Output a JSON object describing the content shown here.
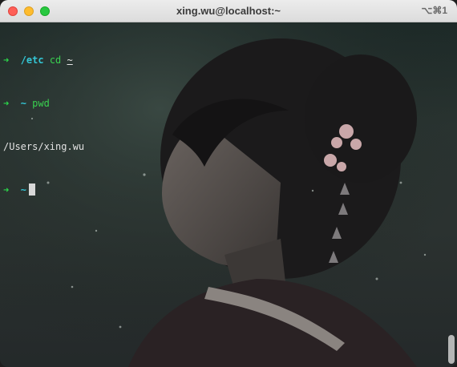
{
  "window": {
    "title": "xing.wu@localhost:~",
    "shortcut": "⌥⌘1"
  },
  "terminal": {
    "line1": {
      "prompt": "➜",
      "dir": "/etc",
      "command": "cd",
      "arg": "~"
    },
    "line2": {
      "prompt": "➜",
      "dir": "~",
      "command": "pwd"
    },
    "line3": {
      "output": "/Users/xing.wu"
    },
    "line4": {
      "prompt": "➜",
      "dir": "~"
    }
  },
  "background": {
    "image": "anime-girl-with-flower-hair-ornament"
  },
  "colors": {
    "prompt_arrow": "#2bd64a",
    "directory": "#34c7d6",
    "command": "#39d04f",
    "text": "#e2e2e2",
    "close": "#fe5f57",
    "minimize": "#febc2e",
    "maximize": "#28c840"
  }
}
